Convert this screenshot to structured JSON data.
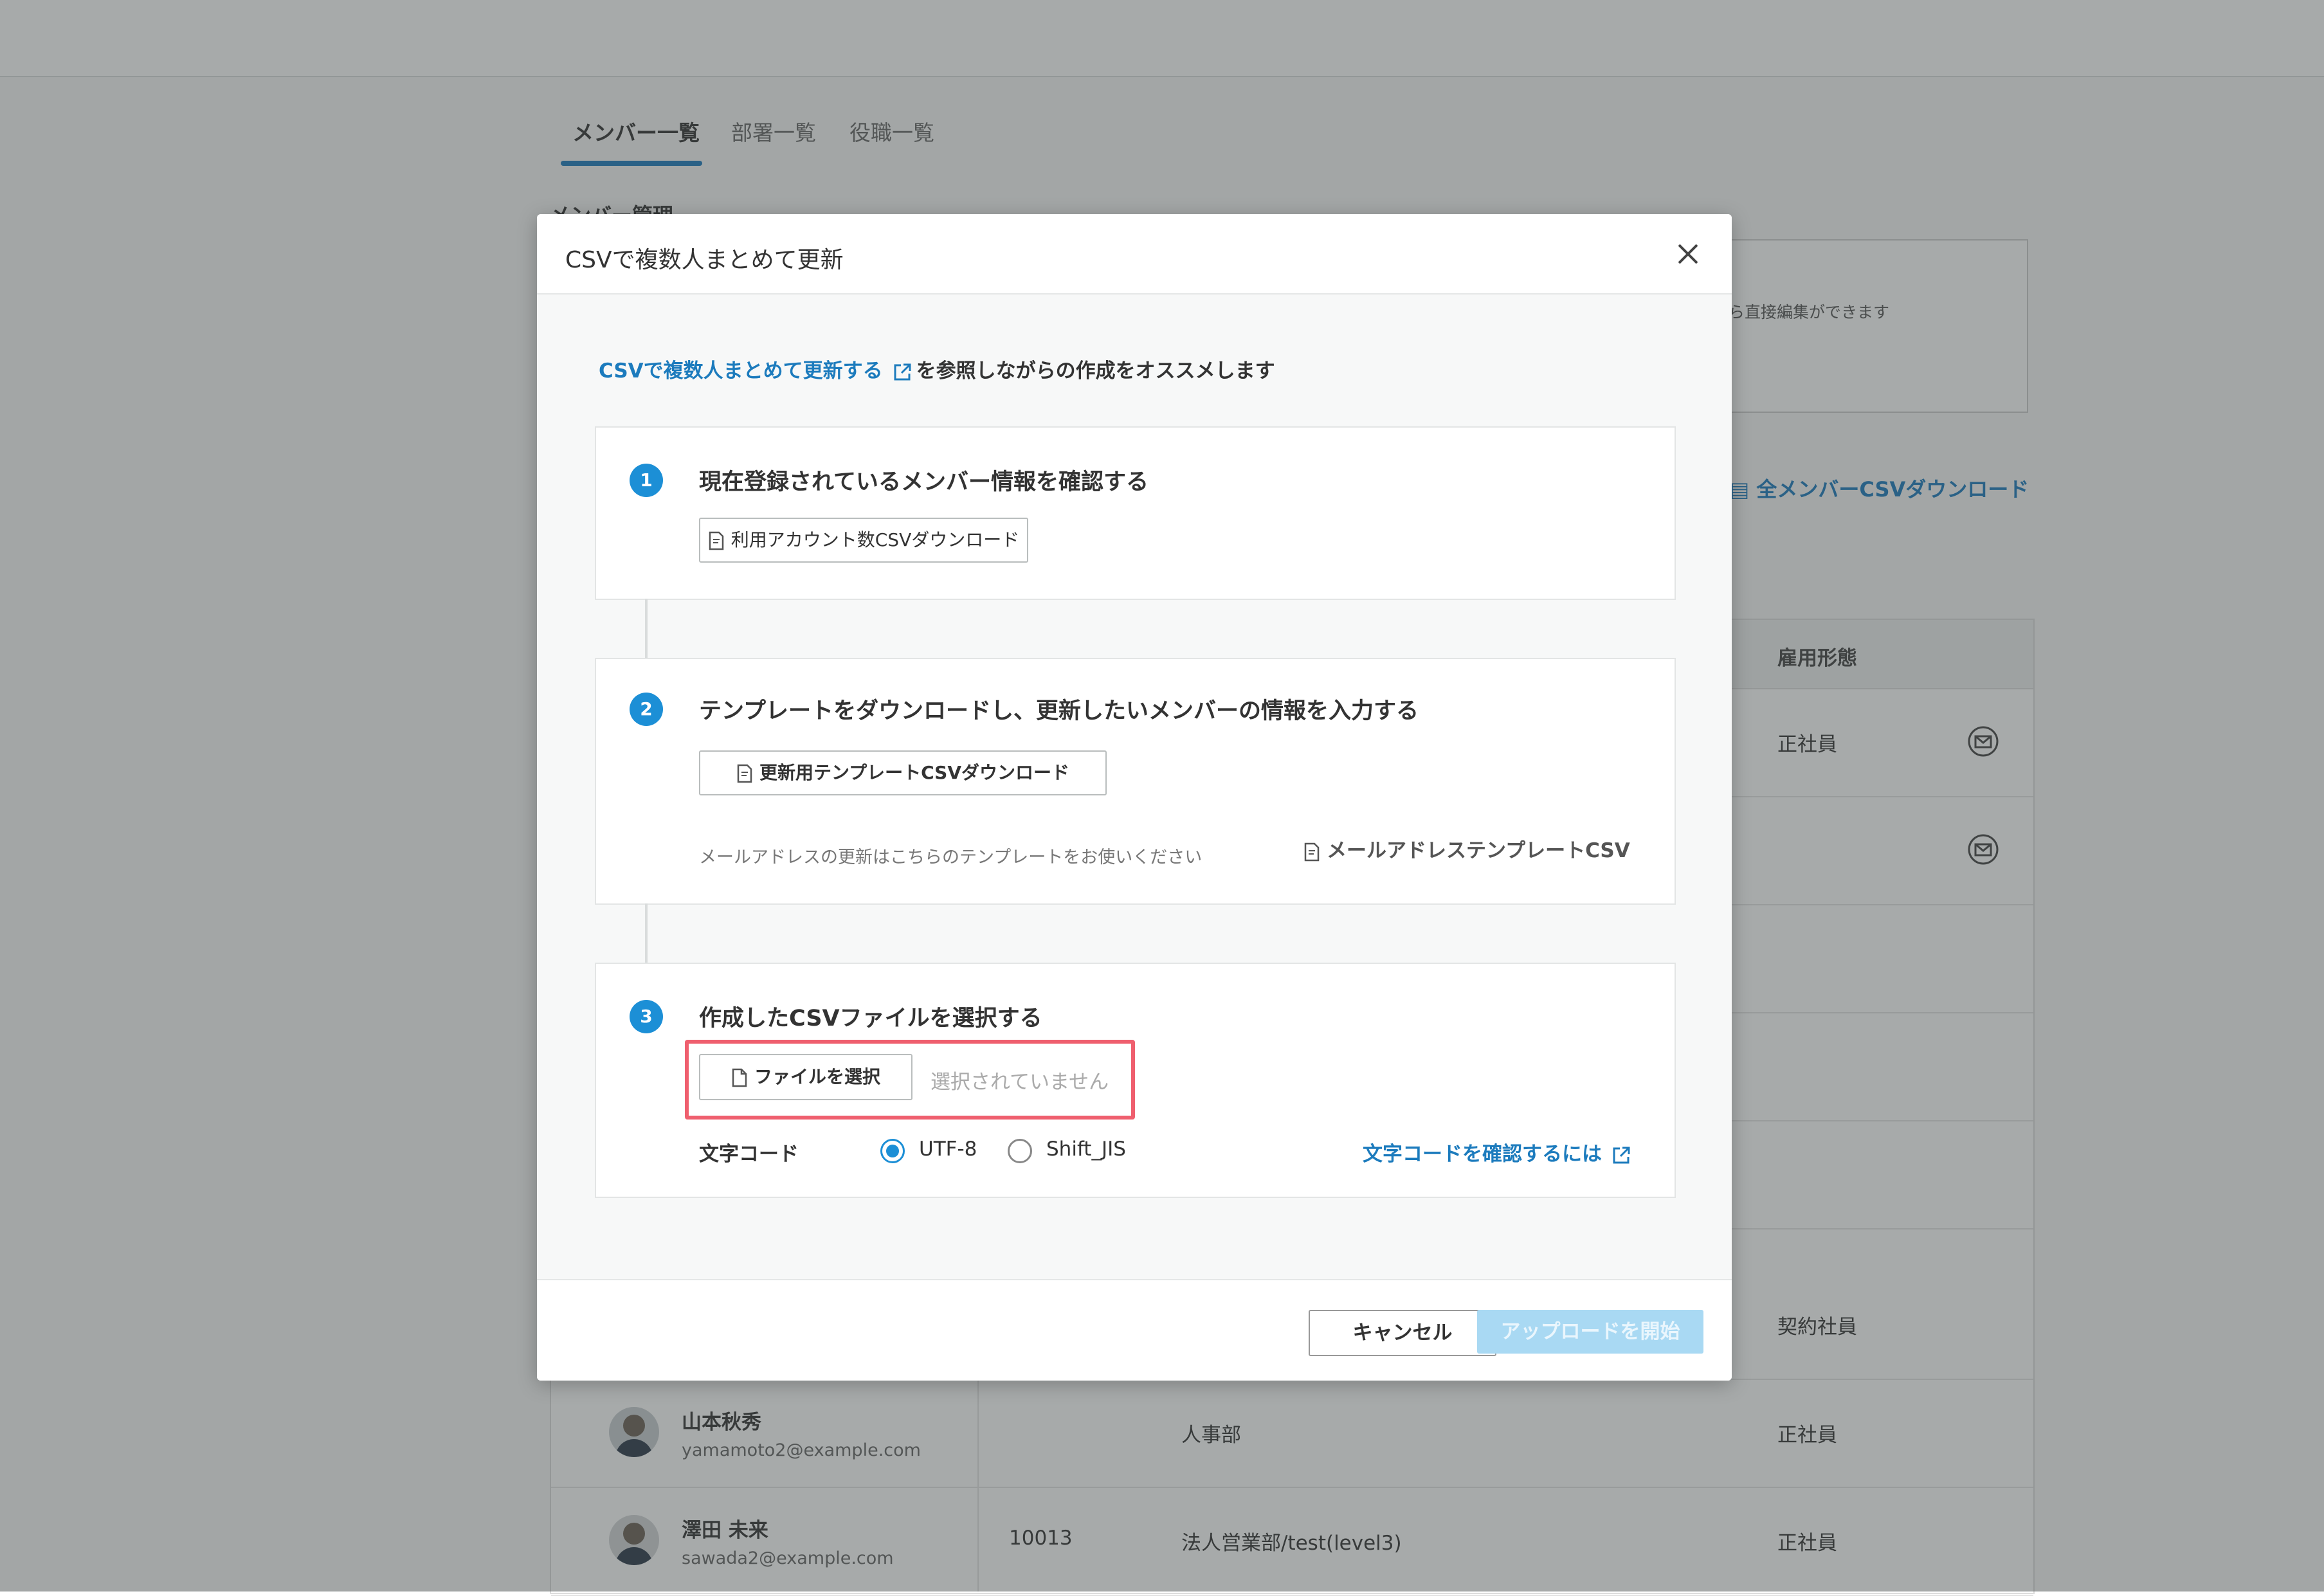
{
  "tabs": [
    {
      "label": "メンバー一覧",
      "active": true
    },
    {
      "label": "部署一覧",
      "active": false
    },
    {
      "label": "役職一覧",
      "active": false
    }
  ],
  "background": {
    "section_title": "メンバー管理",
    "info_text": "ら直接編集ができます",
    "download_all": "全メンバーCSVダウンロード",
    "column_employment": "雇用形態",
    "rows": [
      {
        "employment": "正社員"
      },
      {
        "employment": ""
      },
      {
        "employment": ""
      },
      {
        "employment": ""
      },
      {
        "employment": ""
      },
      {
        "employment": "契約社員"
      },
      {
        "name": "山本秋秀",
        "email": "yamamoto2@example.com",
        "code": "",
        "department": "人事部",
        "employment": "正社員"
      },
      {
        "name": "澤田 未来",
        "email": "sawada2@example.com",
        "code": "10013",
        "department": "法人営業部/test(level3)",
        "employment": "正社員"
      }
    ]
  },
  "modal": {
    "title": "CSVで複数人まとめて更新",
    "intro_link": "CSVで複数人まとめて更新する",
    "intro_text": "を参照しながらの作成をオススメします",
    "step1": {
      "number": "1",
      "title": "現在登録されているメンバー情報を確認する",
      "button": "利用アカウント数CSVダウンロード"
    },
    "step2": {
      "number": "2",
      "title": "テンプレートをダウンロードし、更新したいメンバーの情報を入力する",
      "button": "更新用テンプレートCSVダウンロード",
      "note": "メールアドレスの更新はこちらのテンプレートをお使いください",
      "mail_template": "メールアドレステンプレートCSV"
    },
    "step3": {
      "number": "3",
      "title": "作成したCSVファイルを選択する",
      "file_button": "ファイルを選択",
      "file_status": "選択されていません",
      "encoding_label": "文字コード",
      "encoding_options": [
        {
          "label": "UTF-8",
          "checked": true
        },
        {
          "label": "Shift_JIS",
          "checked": false
        }
      ],
      "encoding_link": "文字コードを確認するには"
    },
    "cancel": "キャンセル",
    "upload": "アップロードを開始"
  },
  "colors": {
    "accent": "#1c8fd6",
    "link": "#1c7bbd",
    "highlight": "#ef5f6e",
    "upload_disabled": "#a9d9f3"
  }
}
